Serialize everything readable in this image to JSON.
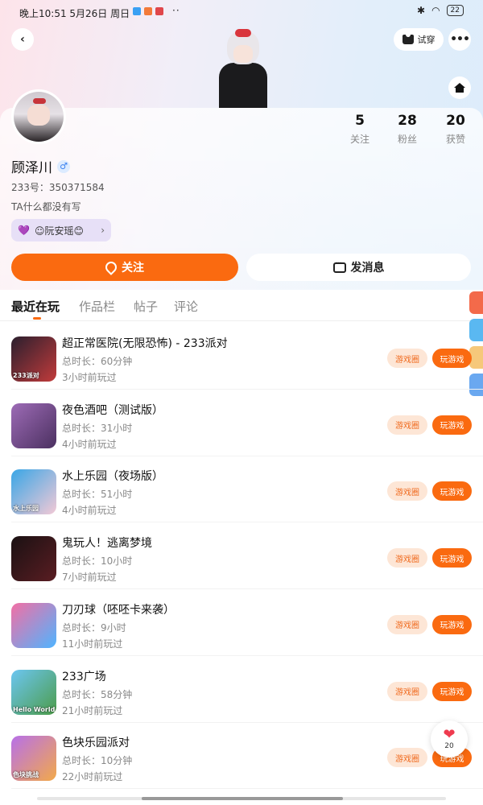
{
  "status_bar": {
    "time": "晚上10:51  5月26日 周日",
    "dots": "··",
    "battery": "22"
  },
  "header": {
    "tryon_label": "试穿"
  },
  "profile": {
    "name": "顾泽川",
    "gender_symbol": "♂",
    "uid": "233号：350371584",
    "bio": "TA什么都没有写",
    "tag": "☺阮安瑶😊",
    "stats": [
      {
        "num": "5",
        "label": "关注"
      },
      {
        "num": "28",
        "label": "粉丝"
      },
      {
        "num": "20",
        "label": "获赞"
      }
    ]
  },
  "actions": {
    "follow": "关注",
    "message": "发消息"
  },
  "tabs": [
    "最近在玩",
    "作品栏",
    "帖子",
    "评论"
  ],
  "games": [
    {
      "title": "超正常医院(无限恐怖) - 233派对",
      "duration": "总时长：60分钟",
      "ago": "3小时前玩过",
      "thumb_label": "233派对",
      "thumb_colors": [
        "#2a1f2e",
        "#c23b3b"
      ]
    },
    {
      "title": "夜色酒吧（测试版）",
      "duration": "总时长：31小时",
      "ago": "4小时前玩过",
      "thumb_label": "",
      "thumb_colors": [
        "#9d6bb6",
        "#4b3060"
      ]
    },
    {
      "title": "水上乐园（夜场版）",
      "duration": "总时长：51小时",
      "ago": "4小时前玩过",
      "thumb_label": "水上乐园",
      "thumb_colors": [
        "#39a6e6",
        "#f3c9d6"
      ]
    },
    {
      "title": "鬼玩人！逃离梦境",
      "duration": "总时长：10小时",
      "ago": "7小时前玩过",
      "thumb_label": "",
      "thumb_colors": [
        "#1a1113",
        "#5a1d22"
      ]
    },
    {
      "title": "刀刃球（呸呸卡来袭）",
      "duration": "总时长：9小时",
      "ago": "11小时前玩过",
      "thumb_label": "",
      "thumb_colors": [
        "#f36fa4",
        "#4fb4ff"
      ]
    },
    {
      "title": "233广场",
      "duration": "总时长：58分钟",
      "ago": "21小时前玩过",
      "thumb_label": "Hello World",
      "thumb_colors": [
        "#6cc6f2",
        "#4c9c49"
      ]
    },
    {
      "title": "色块乐园派对",
      "duration": "总时长：10分钟",
      "ago": "22小时前玩过",
      "thumb_label": "色块挑战",
      "thumb_colors": [
        "#b770e9",
        "#f2a94a"
      ]
    }
  ],
  "game_buttons": {
    "circle": "游戏圈",
    "play": "玩游戏"
  },
  "like_fab": {
    "count": "20"
  },
  "colors": {
    "accent": "#fa6a10",
    "accent_light": "#fde6d6"
  }
}
